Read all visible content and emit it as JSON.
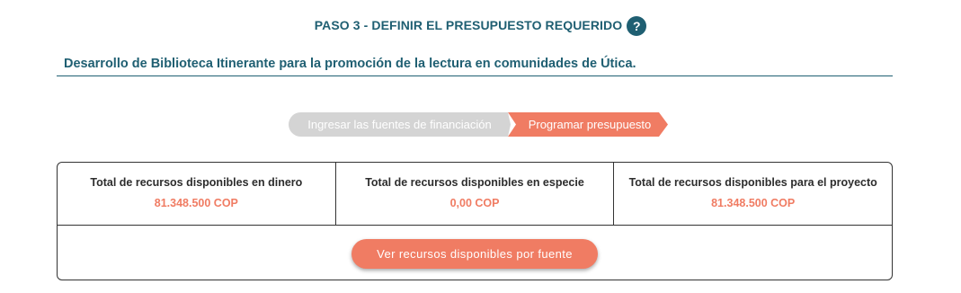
{
  "header": {
    "step_title": "PASO 3 - DEFINIR EL PRESUPUESTO REQUERIDO",
    "help_icon_glyph": "?"
  },
  "project": {
    "title": "Desarrollo de Biblioteca Itinerante para la promoción de la lectura en comunidades de Útica."
  },
  "stepper": {
    "steps": [
      {
        "label": "Ingresar las fuentes de financiación",
        "state": "inactive"
      },
      {
        "label": "Programar presupuesto",
        "state": "active"
      }
    ]
  },
  "summary": {
    "cells": [
      {
        "label": "Total de recursos disponibles en dinero",
        "value": "81.348.500 COP"
      },
      {
        "label": "Total de recursos disponibles en especie",
        "value": "0,00 COP"
      },
      {
        "label": "Total de recursos disponibles para el proyecto",
        "value": "81.348.500 COP"
      }
    ],
    "button_label": "Ver recursos disponibles por fuente"
  },
  "colors": {
    "primary": "#1f5f72",
    "accent": "#f07c63",
    "inactive": "#d4d4d4"
  }
}
